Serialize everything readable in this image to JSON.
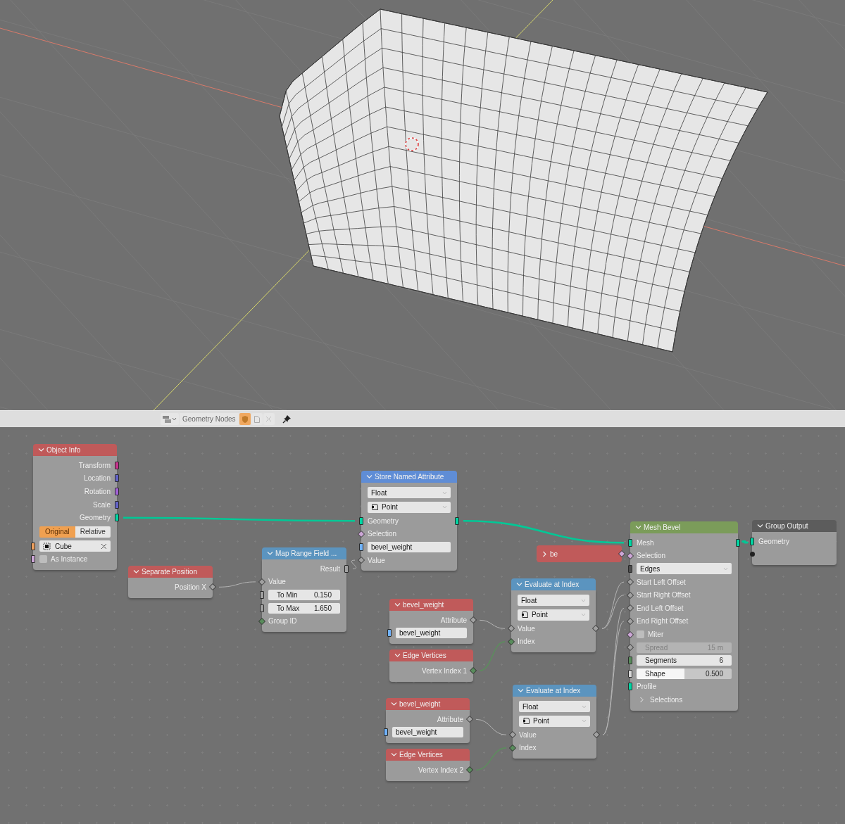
{
  "header": {
    "datablock": "Geometry Nodes",
    "fake_user": true
  },
  "nodes": [
    {
      "title": "Object Info",
      "color": "#c05a5a",
      "expanded": true,
      "rows": [
        {
          "kind": "output",
          "label": "Transform",
          "color": "#c8338e",
          "field": false
        },
        {
          "kind": "output",
          "label": "Location",
          "color": "#6363c7",
          "field": false
        },
        {
          "kind": "output",
          "label": "Rotation",
          "color": "#a363d7",
          "field": false
        },
        {
          "kind": "output",
          "label": "Scale",
          "color": "#6363c7",
          "field": false
        },
        {
          "kind": "output",
          "label": "Geometry",
          "color": "#00d6a3",
          "field": false
        },
        {
          "kind": "segmented",
          "options": [
            {
              "label": "Original",
              "selected": true
            },
            {
              "label": "Relative",
              "selected": false
            }
          ]
        },
        {
          "kind": "object",
          "value": "Cube",
          "color": "#ed9e5c",
          "field": false
        },
        {
          "kind": "checkbox",
          "label": "As Instance",
          "checked": false,
          "color": "#cca6d6",
          "field": false
        }
      ]
    },
    {
      "title": "Separate Position",
      "color": "#c05a5a",
      "expanded": true,
      "rows": [
        {
          "kind": "output",
          "label": "Position X",
          "color": "#a1a1a1",
          "field": true
        }
      ]
    },
    {
      "title": "Map Range Field ...",
      "color": "#5b94bf",
      "expanded": true,
      "rows": [
        {
          "kind": "output",
          "label": "Result",
          "color": "#a1a1a1",
          "field": false
        },
        {
          "kind": "input",
          "label": "Value",
          "color": "#a1a1a1",
          "field": true
        },
        {
          "kind": "number",
          "label": "To Min",
          "value": "0.150",
          "color": "#a1a1a1",
          "field": false,
          "disabled": false
        },
        {
          "kind": "number",
          "label": "To Max",
          "value": "1.650",
          "color": "#a1a1a1",
          "field": false,
          "disabled": false
        },
        {
          "kind": "input",
          "label": "Group ID",
          "color": "#598c5c",
          "field": true
        }
      ]
    },
    {
      "title": "Store Named Attribute",
      "color": "#5f8dd6",
      "expanded": true,
      "rows": [
        {
          "kind": "dropdown",
          "value": "Float",
          "icon": false
        },
        {
          "kind": "dropdown",
          "value": "Point",
          "icon": true
        },
        {
          "kind": "through",
          "label": "Geometry",
          "color": "#00d6a3",
          "field": false
        },
        {
          "kind": "input",
          "label": "Selection",
          "color": "#cca6d6",
          "field": true
        },
        {
          "kind": "field",
          "value": "bevel_weight",
          "color": "#70b2ff",
          "field": false
        },
        {
          "kind": "input",
          "label": "Value",
          "color": "#a1a1a1",
          "field": true
        }
      ]
    },
    {
      "title": "bevel_weight",
      "color": "#c05a5a",
      "expanded": true,
      "rows": [
        {
          "kind": "output",
          "label": "Attribute",
          "color": "#a1a1a1",
          "field": true
        },
        {
          "kind": "field",
          "value": "bevel_weight",
          "color": "#70b2ff",
          "field": false
        }
      ]
    },
    {
      "title": "Edge Vertices",
      "color": "#c05a5a",
      "expanded": true,
      "rows": [
        {
          "kind": "output",
          "label": "Vertex Index 1",
          "color": "#598c5c",
          "field": true
        }
      ]
    },
    {
      "title": "bevel_weight",
      "color": "#c05a5a",
      "expanded": true,
      "rows": [
        {
          "kind": "output",
          "label": "Attribute",
          "color": "#a1a1a1",
          "field": true
        },
        {
          "kind": "field",
          "value": "bevel_weight",
          "color": "#70b2ff",
          "field": false
        }
      ]
    },
    {
      "title": "Edge Vertices",
      "color": "#c05a5a",
      "expanded": true,
      "rows": [
        {
          "kind": "output",
          "label": "Vertex Index 2",
          "color": "#598c5c",
          "field": true
        }
      ]
    },
    {
      "title": "be",
      "color": "#c05a5a",
      "expanded": false,
      "rows": [
        {
          "kind": "collapsed",
          "color": "#cca6d6",
          "field": true
        }
      ]
    },
    {
      "title": "Evaluate at Index",
      "color": "#5b94bf",
      "expanded": true,
      "rows": [
        {
          "kind": "dropdown",
          "value": "Float",
          "icon": false
        },
        {
          "kind": "dropdown",
          "value": "Point",
          "icon": true
        },
        {
          "kind": "through",
          "label": "Value",
          "color": "#a1a1a1",
          "field": true
        },
        {
          "kind": "input",
          "label": "Index",
          "color": "#598c5c",
          "field": true
        }
      ]
    },
    {
      "title": "Evaluate at Index",
      "color": "#5b94bf",
      "expanded": true,
      "rows": [
        {
          "kind": "dropdown",
          "value": "Float",
          "icon": false
        },
        {
          "kind": "dropdown",
          "value": "Point",
          "icon": true
        },
        {
          "kind": "through",
          "label": "Value",
          "color": "#a1a1a1",
          "field": true
        },
        {
          "kind": "input",
          "label": "Index",
          "color": "#598c5c",
          "field": true
        }
      ]
    },
    {
      "title": "Mesh Bevel",
      "color": "#7b9c5a",
      "expanded": true,
      "rows": [
        {
          "kind": "through",
          "label": "Mesh",
          "color": "#00d6a3",
          "field": false
        },
        {
          "kind": "input",
          "label": "Selection",
          "color": "#cca6d6",
          "field": true
        },
        {
          "kind": "dropdown",
          "value": "Edges",
          "icon": false,
          "color": "#4d4d4d",
          "field": false
        },
        {
          "kind": "input",
          "label": "Start Left Offset",
          "color": "#a1a1a1",
          "field": true
        },
        {
          "kind": "input",
          "label": "Start Right Offset",
          "color": "#a1a1a1",
          "field": true
        },
        {
          "kind": "input",
          "label": "End Left Offset",
          "color": "#a1a1a1",
          "field": true
        },
        {
          "kind": "input",
          "label": "End Right Offset",
          "color": "#a1a1a1",
          "field": true
        },
        {
          "kind": "checkbox",
          "label": "Miter",
          "checked": false,
          "color": "#cca6d6",
          "field": true
        },
        {
          "kind": "number",
          "label": "Spread",
          "value": "15 m",
          "color": "#a1a1a1",
          "field": true,
          "disabled": true
        },
        {
          "kind": "number",
          "label": "Segments",
          "value": "6",
          "color": "#598c5c",
          "field": false,
          "disabled": false
        },
        {
          "kind": "number",
          "label": "Shape",
          "value": "0.500",
          "color": "#d8d8d8",
          "field": false,
          "disabled": false,
          "level": 0.5
        },
        {
          "kind": "input",
          "label": "Profile",
          "color": "#00d6a3",
          "field": false
        },
        {
          "kind": "panel",
          "label": "Selections",
          "expanded": false
        }
      ]
    },
    {
      "title": "Group Output",
      "color": "#5c5c5c",
      "expanded": true,
      "rows": [
        {
          "kind": "input",
          "label": "Geometry",
          "color": "#00d6a3",
          "field": false
        },
        {
          "kind": "empty",
          "color": "#222222",
          "field": false
        }
      ]
    }
  ]
}
